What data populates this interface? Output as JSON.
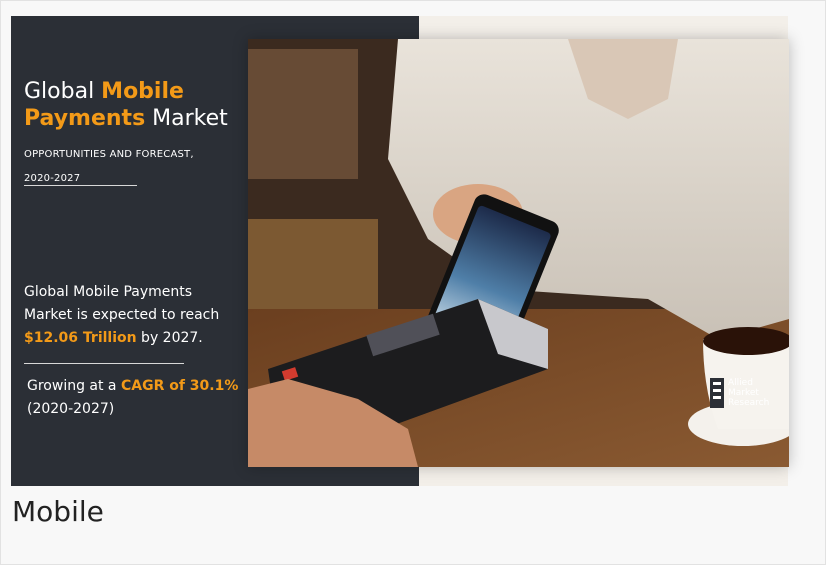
{
  "banner": {
    "title_prefix": "Global ",
    "title_accent": "Mobile Payments",
    "title_suffix": " Market",
    "subtitle_line1": "OPPORTUNITIES AND FORECAST,",
    "subtitle_line2": "2020-2027",
    "stat_text": "Global Mobile Payments Market is expected to reach ",
    "stat_value": "$12.06 Trillion",
    "stat_suffix": " by 2027.",
    "cagr_prefix": "Growing at a ",
    "cagr_value": "CAGR of 30.1%",
    "cagr_period": "(2020-2027)",
    "logo_line1": "Allied",
    "logo_line2": "Market",
    "logo_line3": "Research",
    "accent_color": "#f39a18",
    "panel_color": "#2b2f36"
  },
  "caption": "Mobile"
}
